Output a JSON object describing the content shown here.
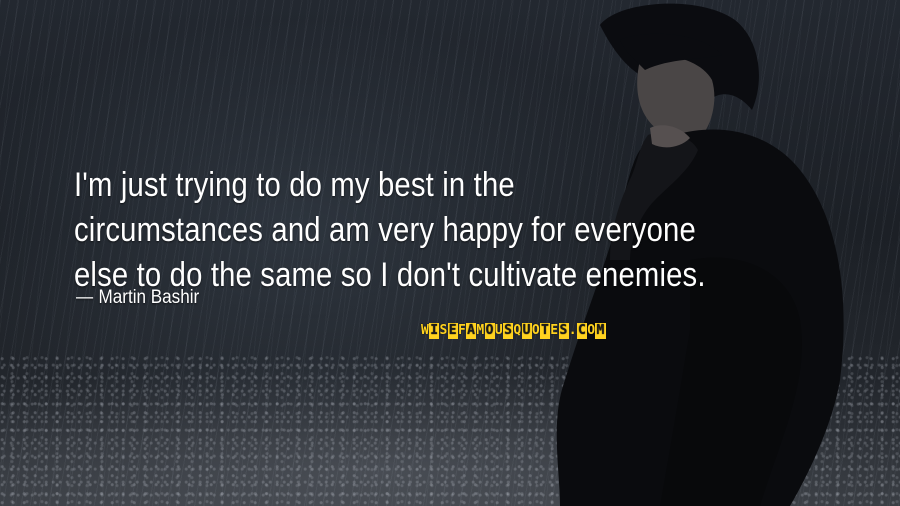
{
  "quote": {
    "lines": [
      "I'm just trying to do my best in the",
      "circumstances and am very happy for everyone",
      "else to do the same so I don't cultivate enemies."
    ],
    "author": "Martin Bashir",
    "author_dash": "—"
  },
  "watermark": {
    "text": "WISEFAMOUSQUOTES.COM"
  },
  "colors": {
    "text": "#ffffff",
    "logo_yellow": "#ffd21f",
    "background": "#1c2026"
  },
  "icons": {
    "figure": "sad-person-illustration"
  }
}
